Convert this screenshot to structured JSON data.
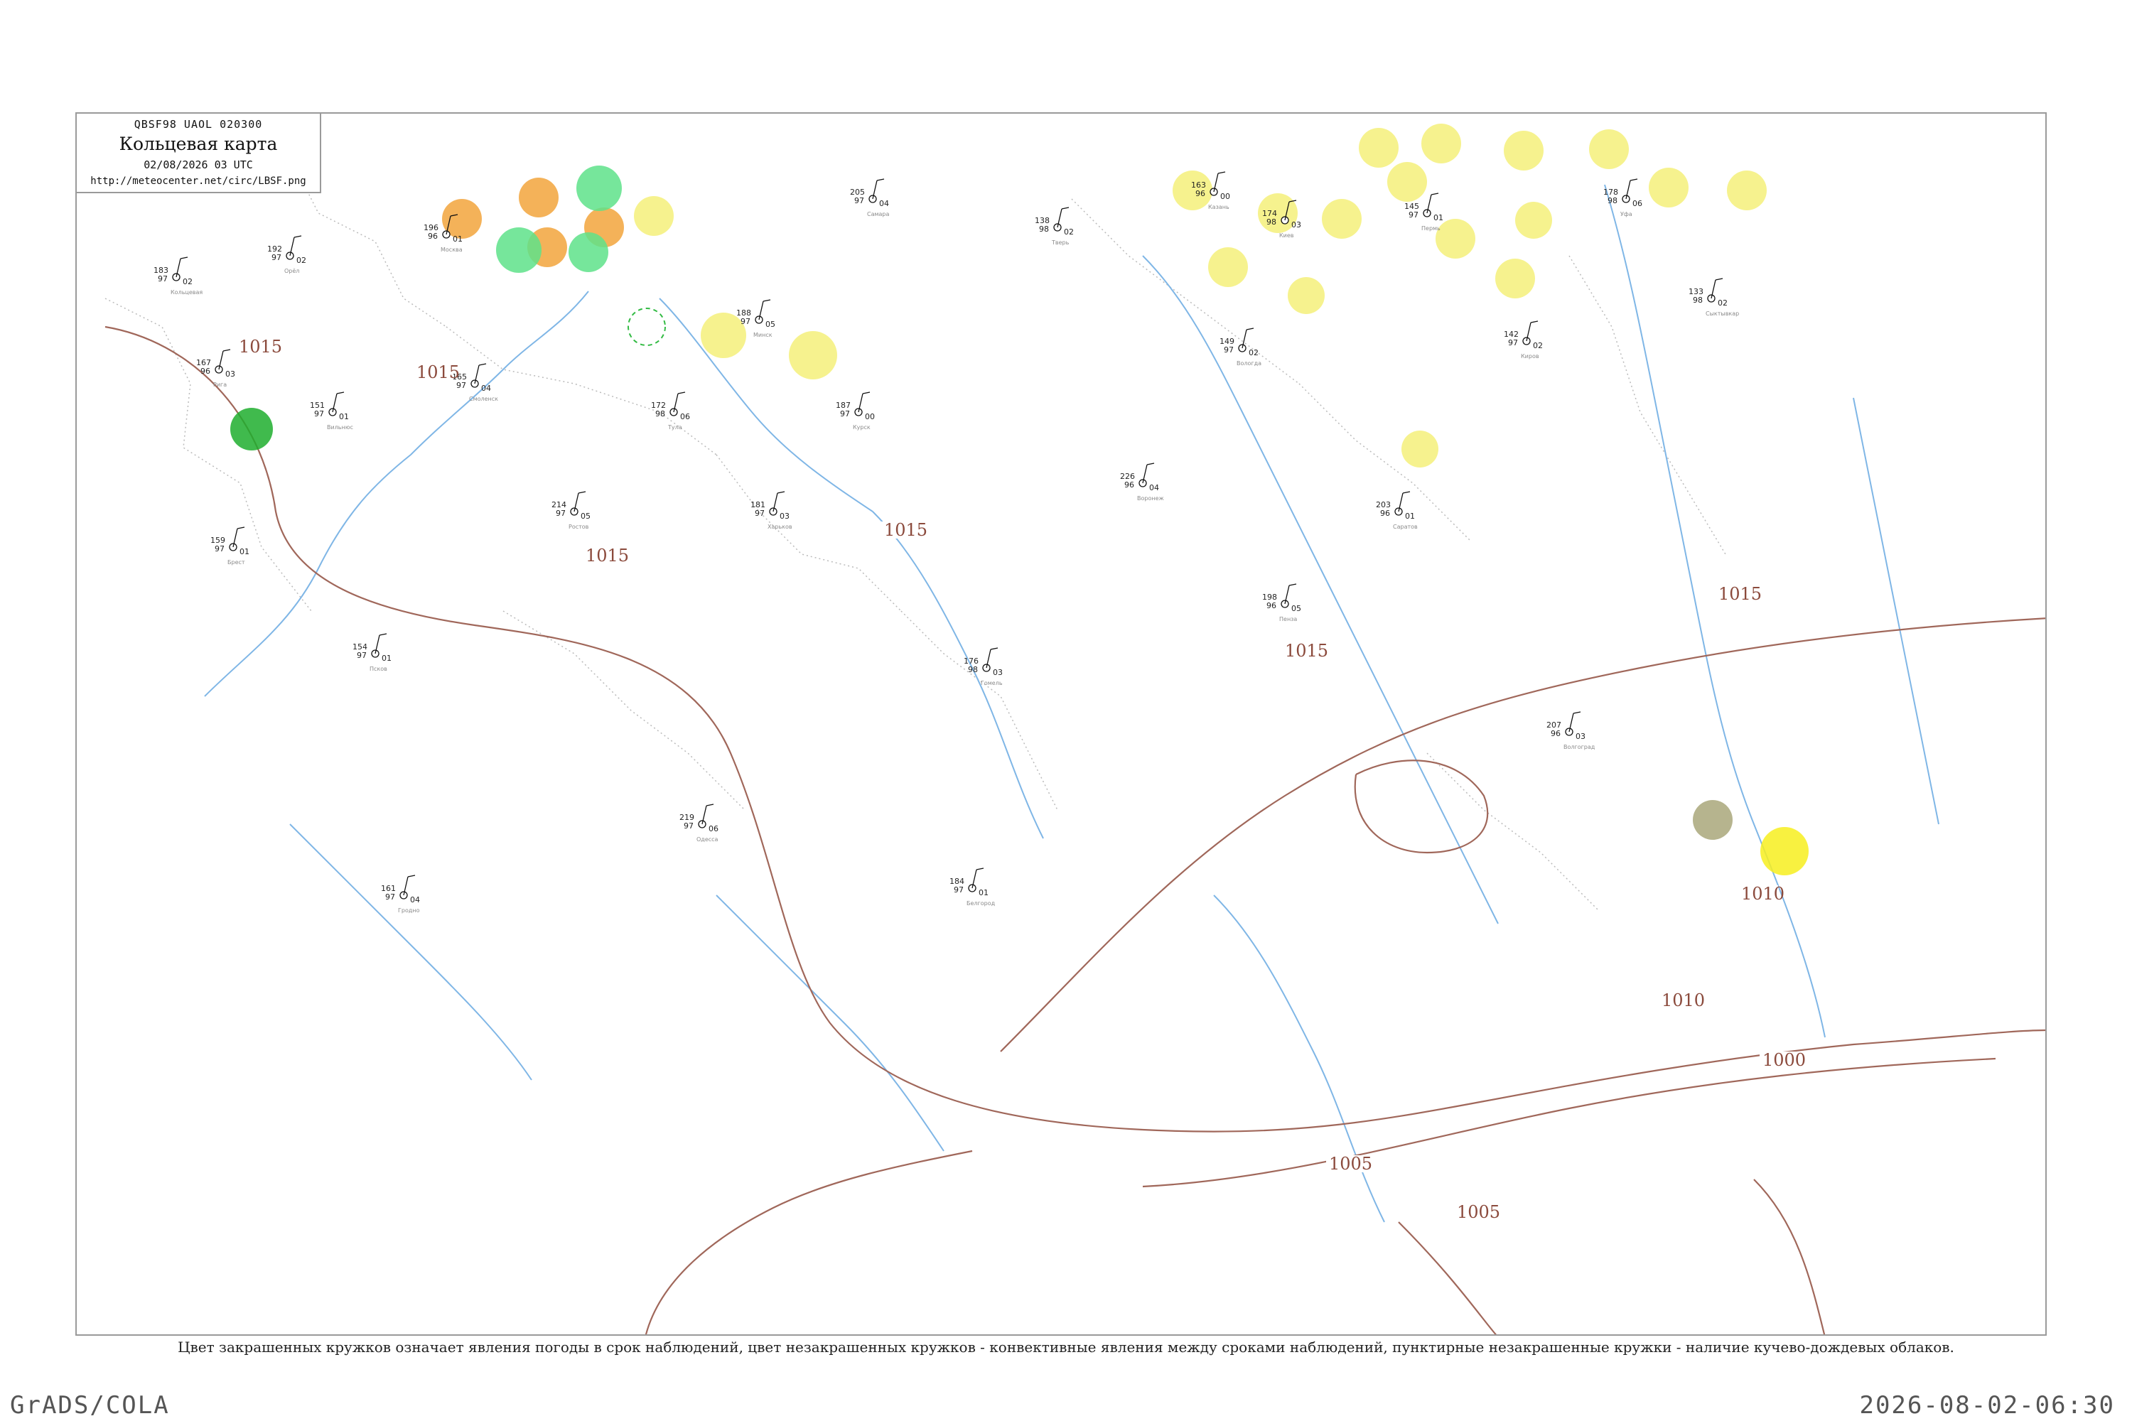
{
  "header": {
    "code": "QBSF98  UAOL  020300",
    "title": "Кольцевая карта",
    "date": "02/08/2026 03 UTC",
    "url": "http://meteocenter.net/circ/LBSF.png"
  },
  "footnote": "Цвет закрашенных кружков означает явления погоды в срок наблюдений, цвет незакрашенных кружков - конвективные явления между сроками наблюдений, пунктирные незакрашенные кружки - наличие кучево-дождевых облаков.",
  "footer": {
    "software": "GrADS/COLA",
    "timestamp": "2026-08-02-06:30"
  },
  "isobar_labels": [
    "1015",
    "1015",
    "1015",
    "1015",
    "1015",
    "1010",
    "1010",
    "1005",
    "1005",
    "1000",
    "1015"
  ],
  "colors": {
    "rain": "#f5f07a",
    "thunder": "#f2a43c",
    "shower": "#5ee28a",
    "heavy_rain": "#1fae2e",
    "fog": "#a9a77a",
    "cb_dashed": "#33bb44",
    "isobar": "#a0675a",
    "river": "#7fb6e6",
    "border": "#bbbbbb"
  },
  "stations": [
    {
      "t": "183",
      "p": "97",
      "d": "02",
      "n": "Кольцевая"
    },
    {
      "t": "196",
      "p": "96",
      "d": "01",
      "n": "Москва"
    },
    {
      "t": "188",
      "p": "97",
      "d": "05",
      "n": "Минск"
    },
    {
      "t": "174",
      "p": "98",
      "d": "03",
      "n": "Киев"
    },
    {
      "t": "163",
      "p": "96",
      "d": "00",
      "n": "Казань"
    },
    {
      "t": "205",
      "p": "97",
      "d": "04",
      "n": "Самара"
    },
    {
      "t": "145",
      "p": "97",
      "d": "01",
      "n": "Пермь"
    },
    {
      "t": "178",
      "p": "98",
      "d": "06",
      "n": "Уфа"
    },
    {
      "t": "192",
      "p": "97",
      "d": "02",
      "n": "Орёл"
    },
    {
      "t": "167",
      "p": "96",
      "d": "03",
      "n": "Рига"
    },
    {
      "t": "151",
      "p": "97",
      "d": "01",
      "n": "Вильнюс"
    },
    {
      "t": "214",
      "p": "97",
      "d": "05",
      "n": "Ростов"
    },
    {
      "t": "138",
      "p": "98",
      "d": "02",
      "n": "Тверь"
    },
    {
      "t": "226",
      "p": "96",
      "d": "04",
      "n": "Воронеж"
    },
    {
      "t": "159",
      "p": "97",
      "d": "01",
      "n": "Брест"
    },
    {
      "t": "181",
      "p": "97",
      "d": "03",
      "n": "Харьков"
    },
    {
      "t": "172",
      "p": "98",
      "d": "06",
      "n": "Тула"
    },
    {
      "t": "149",
      "p": "97",
      "d": "02",
      "n": "Вологда"
    },
    {
      "t": "203",
      "p": "96",
      "d": "01",
      "n": "Саратов"
    },
    {
      "t": "165",
      "p": "97",
      "d": "04",
      "n": "Смоленск"
    },
    {
      "t": "187",
      "p": "97",
      "d": "00",
      "n": "Курск"
    },
    {
      "t": "176",
      "p": "98",
      "d": "03",
      "n": "Гомель"
    },
    {
      "t": "142",
      "p": "97",
      "d": "02",
      "n": "Киров"
    },
    {
      "t": "198",
      "p": "96",
      "d": "05",
      "n": "Пенза"
    },
    {
      "t": "154",
      "p": "97",
      "d": "01",
      "n": "Псков"
    },
    {
      "t": "219",
      "p": "97",
      "d": "06",
      "n": "Одесса"
    },
    {
      "t": "133",
      "p": "98",
      "d": "02",
      "n": "Сыктывкар"
    },
    {
      "t": "207",
      "p": "96",
      "d": "03",
      "n": "Волгоград"
    },
    {
      "t": "161",
      "p": "97",
      "d": "04",
      "n": "Гродно"
    },
    {
      "t": "184",
      "p": "97",
      "d": "01",
      "n": "Белгород"
    }
  ],
  "weather_markers": [
    {
      "kind": "thunder"
    },
    {
      "kind": "thunder"
    },
    {
      "kind": "thunder"
    },
    {
      "kind": "thunder"
    },
    {
      "kind": "shower"
    },
    {
      "kind": "shower"
    },
    {
      "kind": "shower"
    },
    {
      "kind": "rain"
    },
    {
      "kind": "rain"
    },
    {
      "kind": "rain"
    },
    {
      "kind": "rain"
    },
    {
      "kind": "rain"
    },
    {
      "kind": "rain"
    },
    {
      "kind": "rain"
    },
    {
      "kind": "rain"
    },
    {
      "kind": "rain"
    },
    {
      "kind": "rain"
    },
    {
      "kind": "rain"
    },
    {
      "kind": "rain"
    },
    {
      "kind": "rain"
    },
    {
      "kind": "rain"
    },
    {
      "kind": "rain"
    },
    {
      "kind": "rain"
    },
    {
      "kind": "rain"
    },
    {
      "kind": "rain"
    },
    {
      "kind": "rain"
    },
    {
      "kind": "heavy_rain"
    },
    {
      "kind": "fog"
    },
    {
      "kind": "rain_bright"
    },
    {
      "kind": "cb_dashed"
    }
  ]
}
